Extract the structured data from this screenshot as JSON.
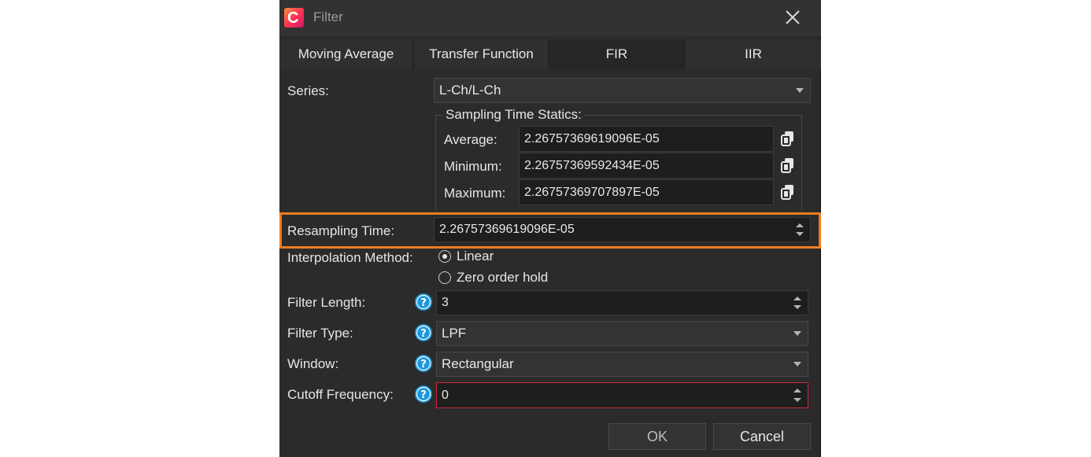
{
  "window": {
    "title": "Filter",
    "logo_letter": "C"
  },
  "tabs": [
    {
      "label": "Moving Average",
      "active": false
    },
    {
      "label": "Transfer Function",
      "active": false
    },
    {
      "label": "FIR",
      "active": true
    },
    {
      "label": "IIR",
      "active": false
    }
  ],
  "series": {
    "label": "Series:",
    "value": "L-Ch/L-Ch"
  },
  "sampling": {
    "title": "Sampling Time Statics:",
    "average_label": "Average:",
    "average_value": "2.26757369619096E-05",
    "minimum_label": "Minimum:",
    "minimum_value": "2.26757369592434E-05",
    "maximum_label": "Maximum:",
    "maximum_value": "2.26757369707897E-05"
  },
  "resampling": {
    "label": "Resampling Time:",
    "value": "2.26757369619096E-05"
  },
  "interpolation": {
    "label": "Interpolation Method:",
    "options": [
      {
        "label": "Linear",
        "selected": true
      },
      {
        "label": "Zero order hold",
        "selected": false
      }
    ]
  },
  "filter_length": {
    "label": "Filter Length:",
    "value": "3"
  },
  "filter_type": {
    "label": "Filter Type:",
    "value": "LPF"
  },
  "window_fn": {
    "label": "Window:",
    "value": "Rectangular"
  },
  "cutoff": {
    "label": "Cutoff Frequency:",
    "value": "0"
  },
  "buttons": {
    "ok": "OK",
    "cancel": "Cancel"
  },
  "colors": {
    "highlight": "#ee7d21",
    "error_border": "#c8283c",
    "help_icon": "#1f97d8",
    "background": "#2b2b2b"
  }
}
